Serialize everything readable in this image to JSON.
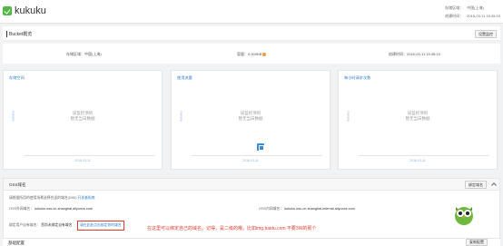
{
  "header": {
    "bucket_name": "kukuku",
    "region_label": "存储区域：",
    "region_value": "中国(上海)",
    "storage_label": "容量：",
    "storage_value": "0.000KB",
    "created_label": "创建时间：",
    "created_value": "2016-03-11 15:35:19"
  },
  "title": {
    "text": "Bucket概览",
    "button": "设置监控"
  },
  "info": {
    "region": "存储区域：中国(上海)",
    "storage": "容量：0.000KB",
    "created": "创建时间：2016-03-11 15:35:19"
  },
  "cards": [
    {
      "title": "存储空间",
      "ylabel": "kubuku",
      "empty1": "该监控项的",
      "empty2": "暂无当日数据",
      "date": "2016-03-11"
    },
    {
      "title": "使用流量",
      "ylabel": "kubuku",
      "empty1": "该监控项的",
      "empty2": "暂无当日数据",
      "date": "2016-03-11"
    },
    {
      "title": "每小时请求次数",
      "ylabel": "kubuku",
      "empty1": "该监控项的",
      "empty2": "暂无当日数据",
      "date": "2016-03-11"
    }
  ],
  "oss": {
    "title": "OSS域名",
    "button": "绑定域名",
    "note": "请根据所用的使用场景选择合适的域名(0/90)",
    "note_link": "开发者指南",
    "outer_label": "OSS外网域名：",
    "outer_value": "kukuku.oss-cn-shanghai.aliyuncs.com",
    "inner_label": "OSS内网域名：",
    "inner_value": "kukuku.oss-cn-shanghai-internal.aliyuncs.com",
    "bind_label": "绑定用户自有域名：",
    "bind_desc": "您尚未绑定自有域名",
    "bind_link": "请在此处点击绑定你的域名",
    "annotation": "在这里可以绑定自己的域名，记得，是二级的哦，比如img.baidu.com 不要3W的那个"
  },
  "bottom": {
    "title": "基础配置",
    "button": "复制配置"
  },
  "colors": {
    "accent": "#3380c8",
    "warn": "#e23b2e",
    "logo": "#52b946"
  },
  "icons": {
    "logo": "bucket-logo-icon",
    "warning": "warning-icon",
    "collapse": "chevron-up-icon"
  }
}
